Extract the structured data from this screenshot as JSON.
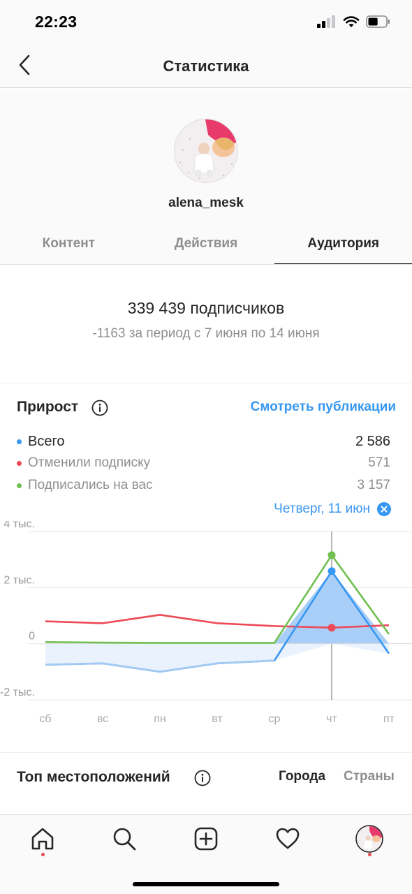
{
  "status_bar": {
    "time": "22:23",
    "battery_level": 0.55
  },
  "nav": {
    "title": "Статистика",
    "back_icon": "chevron-left-icon"
  },
  "profile": {
    "username": "alena_mesk"
  },
  "tabs": [
    {
      "label": "Контент",
      "active": false
    },
    {
      "label": "Действия",
      "active": false
    },
    {
      "label": "Аудитория",
      "active": true
    }
  ],
  "followers": {
    "count_text": "339 439 подписчиков",
    "change_text": "-1163 за период с 7 июня по 14 июня"
  },
  "growth": {
    "title": "Прирост",
    "see_posts_label": "Смотреть публикации",
    "legend": [
      {
        "label": "Всего",
        "value": "2 586",
        "color": "#3897f0"
      },
      {
        "label": "Отменили подписку",
        "value": "571",
        "color": "#ed4956"
      },
      {
        "label": "Подписались на вас",
        "value": "3 157",
        "color": "#70c050"
      }
    ],
    "selected_day": "Четверг, 11 июн"
  },
  "chart_data": {
    "type": "line",
    "categories": [
      "сб",
      "вс",
      "пн",
      "вт",
      "ср",
      "чт",
      "пт"
    ],
    "y_ticks": [
      "4 тыс.",
      "2 тыс.",
      "0",
      "-2 тыс."
    ],
    "ylim": [
      -2000,
      4000
    ],
    "grid": true,
    "series": [
      {
        "name": "Всего",
        "color": "#3897f0",
        "values": [
          -750,
          -700,
          -1000,
          -700,
          -600,
          2586,
          -350
        ]
      },
      {
        "name": "Отменили подписку",
        "color": "#ed4956",
        "values": [
          800,
          730,
          1030,
          730,
          630,
          571,
          660
        ]
      },
      {
        "name": "Подписались на вас",
        "color": "#70c050",
        "values": [
          60,
          40,
          30,
          30,
          30,
          3157,
          340
        ]
      }
    ],
    "highlight_index": 5
  },
  "top_locations": {
    "title": "Топ местоположений",
    "tab_cities": "Города",
    "tab_countries": "Страны"
  },
  "tab_bar": {
    "items": [
      "home-icon",
      "search-icon",
      "add-post-icon",
      "heart-icon",
      "profile-avatar"
    ]
  }
}
